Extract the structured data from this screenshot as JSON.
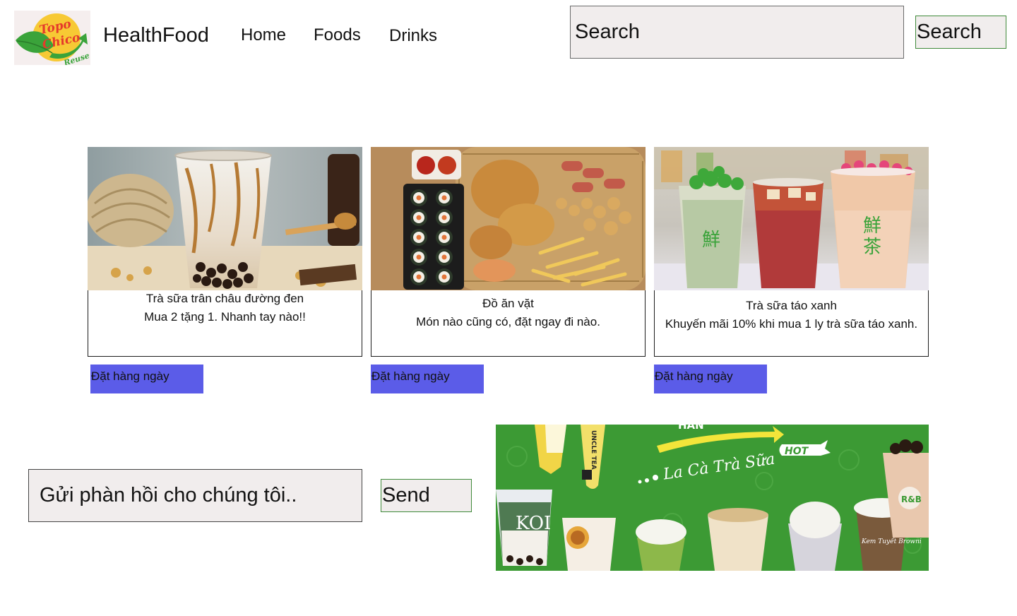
{
  "header": {
    "logo": {
      "wordmark_line1": "Topo",
      "wordmark_line2": "Chico",
      "tagline": "Reuse",
      "colors": {
        "primary": "#e53a2b",
        "badge": "#f7c934",
        "leaf": "#3aa33a"
      }
    },
    "brand": "HealthFood",
    "nav": {
      "home": "Home",
      "foods": "Foods",
      "drinks": "Drinks"
    },
    "search": {
      "placeholder": "Search",
      "button_label": "Search"
    }
  },
  "products": [
    {
      "title": "Trà sữa trân châu đường đen",
      "description": "Mua 2 tặng 1. Nhanh tay nào!!",
      "button_label": "Đặt hàng ngày"
    },
    {
      "title": "Đồ ăn vặt",
      "description": "Món nào cũng có, đặt ngay đi nào.",
      "button_label": "Đặt hàng ngày"
    },
    {
      "title": "Trà sữa táo xanh",
      "description": "Khuyến mãi 10% khi mua 1 ly trà sữa táo xanh.",
      "button_label": "Đặt hàng ngày"
    }
  ],
  "feedback": {
    "placeholder": "Gửi phàn hồi cho chúng tôi..",
    "button_label": "Send"
  },
  "banner": {
    "heading": "HAN",
    "script_text": "La Cà Trà Sữa",
    "badge": "HOT",
    "cup_label": "UNCLE TEA",
    "brand_label": "R&B",
    "koi_label": "KOI",
    "flavor_label": "Kem Tuyết Browni",
    "colors": {
      "background": "#3c9a34",
      "arrow": "#f3e53a"
    }
  },
  "theme": {
    "order_button": "#5b5ce8",
    "input_bg": "#f1eded",
    "button_border": "#3f8a3a"
  }
}
